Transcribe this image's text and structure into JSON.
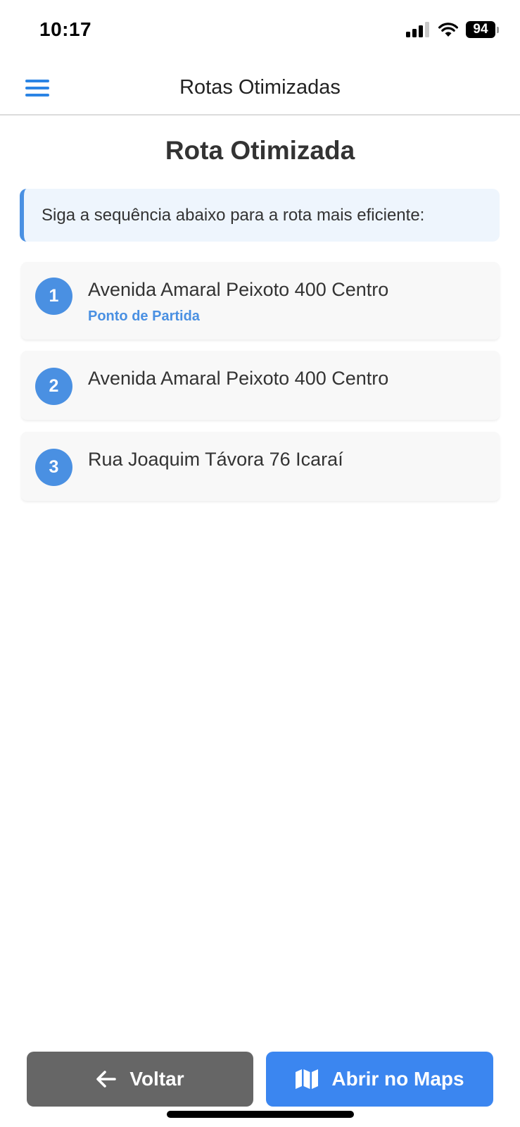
{
  "status_bar": {
    "time": "10:17",
    "battery_level": "94",
    "icons": [
      "cellular-signal-icon",
      "wifi-icon",
      "battery-icon"
    ]
  },
  "header": {
    "title": "Rotas Otimizadas",
    "menu_icon": "hamburger-menu-icon"
  },
  "main": {
    "title": "Rota Otimizada",
    "info": "Siga a sequência abaixo para a rota mais eficiente:",
    "stops": [
      {
        "number": "1",
        "address": "Avenida Amaral Peixoto 400 Centro",
        "label": "Ponto de Partida"
      },
      {
        "number": "2",
        "address": "Avenida Amaral Peixoto 400 Centro"
      },
      {
        "number": "3",
        "address": "Rua Joaquim Távora 76 Icaraí"
      }
    ]
  },
  "actions": {
    "back_label": "Voltar",
    "back_icon": "arrow-left-icon",
    "maps_label": "Abrir no Maps",
    "maps_icon": "map-icon"
  },
  "colors": {
    "accent": "#4a90e2",
    "header_icon": "#2b84e4",
    "back_button": "#666666",
    "maps_button": "#3b86f0",
    "info_background": "#eef5fd",
    "card_background": "#f8f8f8"
  }
}
